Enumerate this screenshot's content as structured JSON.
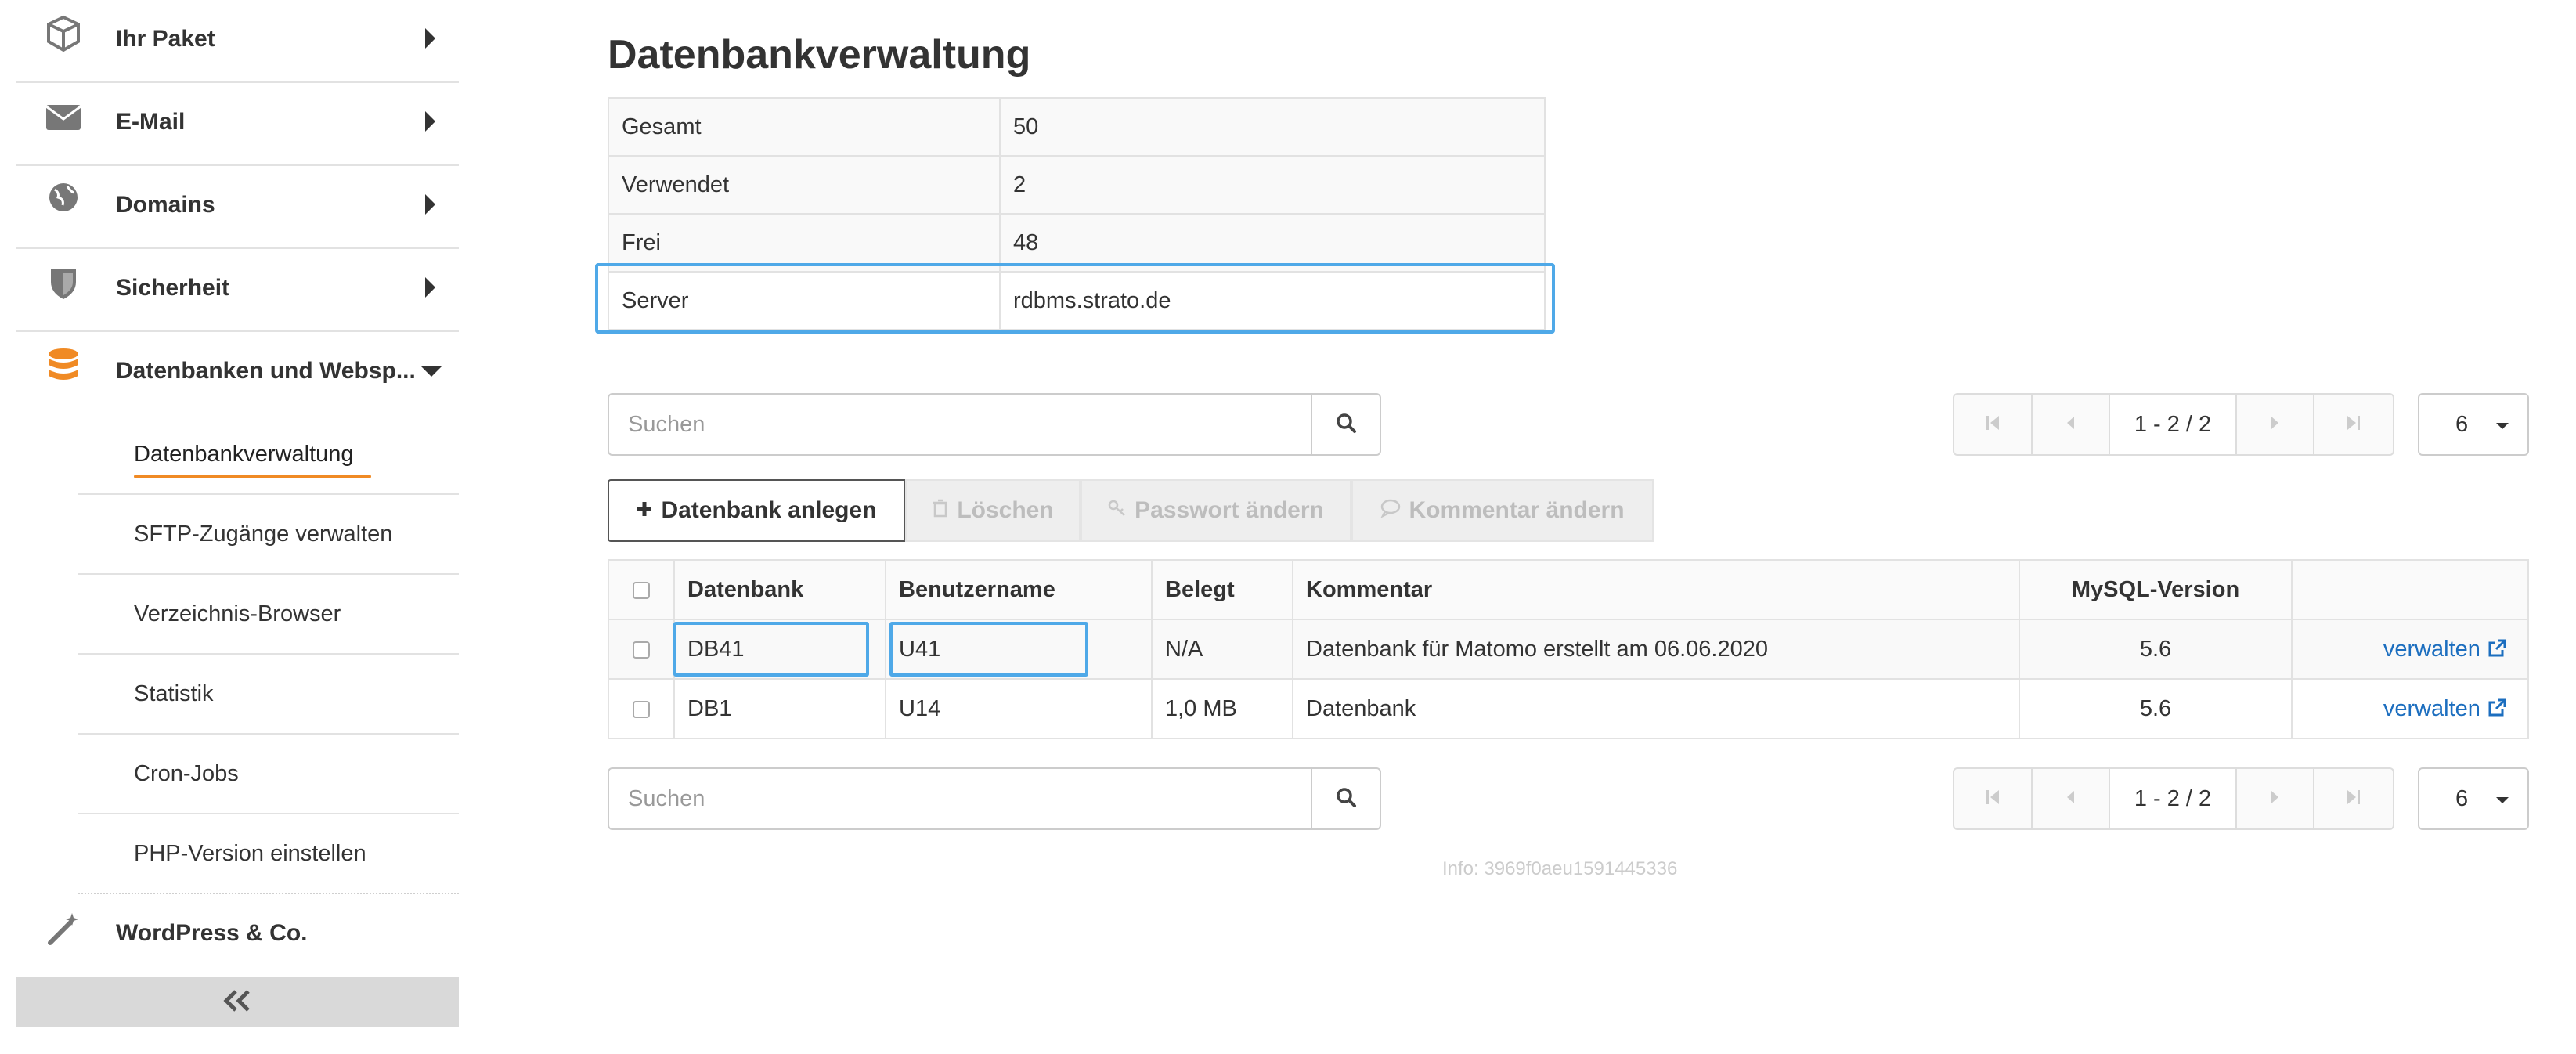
{
  "sidebar": {
    "items": [
      {
        "label": "Ihr Paket",
        "icon": "package-icon"
      },
      {
        "label": "E-Mail",
        "icon": "envelope-icon"
      },
      {
        "label": "Domains",
        "icon": "globe-icon"
      },
      {
        "label": "Sicherheit",
        "icon": "shield-icon"
      },
      {
        "label": "Datenbanken und Websp...",
        "icon": "database-icon"
      }
    ],
    "subitems": [
      {
        "label": "Datenbankverwaltung"
      },
      {
        "label": "SFTP-Zugänge verwalten"
      },
      {
        "label": "Verzeichnis-Browser"
      },
      {
        "label": "Statistik"
      },
      {
        "label": "Cron-Jobs"
      },
      {
        "label": "PHP-Version einstellen"
      }
    ],
    "wordpress": {
      "label": "WordPress & Co.",
      "icon": "magic-wand-icon"
    },
    "collapse_label": "«"
  },
  "main": {
    "title": "Datenbankverwaltung",
    "info": [
      {
        "key": "Gesamt",
        "value": "50"
      },
      {
        "key": "Verwendet",
        "value": "2"
      },
      {
        "key": "Frei",
        "value": "48"
      },
      {
        "key": "Server",
        "value": "rdbms.strato.de"
      }
    ],
    "search_placeholder": "Suchen",
    "pager_info": "1 - 2 / 2",
    "per_page": "6",
    "actions": {
      "create": "Datenbank anlegen",
      "delete": "Löschen",
      "password": "Passwort ändern",
      "comment": "Kommentar ändern"
    },
    "table": {
      "headers": [
        "Datenbank",
        "Benutzername",
        "Belegt",
        "Kommentar",
        "MySQL-Version"
      ],
      "rows": [
        {
          "db": "DB41",
          "user": "U41",
          "used": "N/A",
          "comment": "Datenbank für Matomo erstellt am 06.06.2020",
          "version": "5.6",
          "action": "verwalten"
        },
        {
          "db": "DB1",
          "user": "U14",
          "used": "1,0 MB",
          "comment": "Datenbank",
          "version": "5.6",
          "action": "verwalten"
        }
      ]
    },
    "footer_info": "Info: 3969f0aeu1591445336"
  },
  "colors": {
    "accent": "#f08a24",
    "highlight": "#4fa9e8",
    "link": "#1c6ebf"
  }
}
